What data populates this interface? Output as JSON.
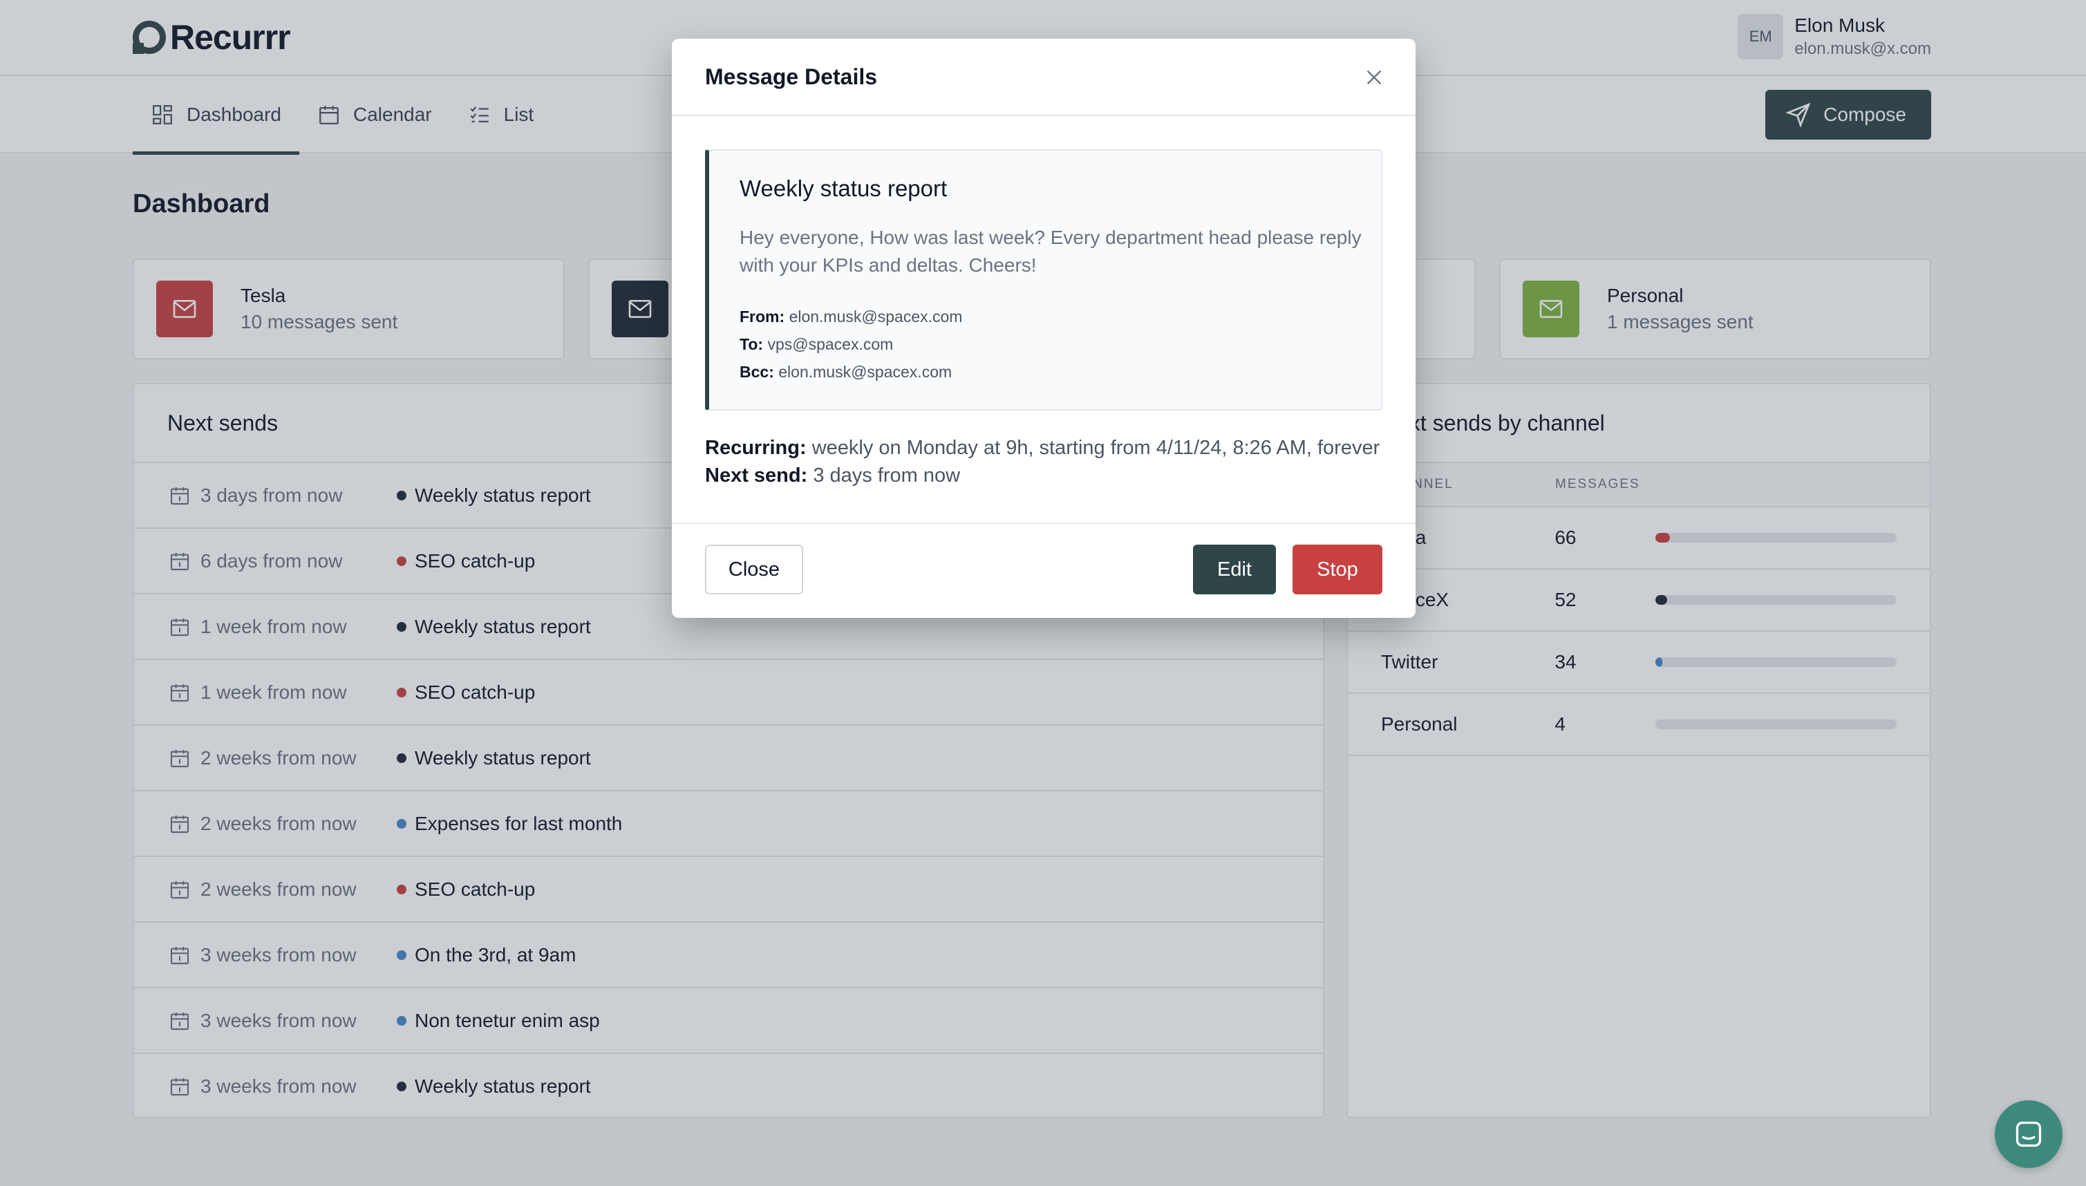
{
  "app": {
    "logo_text": "Recurrr"
  },
  "user": {
    "initials": "EM",
    "name": "Elon Musk",
    "email": "elon.musk@x.com"
  },
  "nav": {
    "tabs": [
      {
        "label": "Dashboard",
        "icon": "dashboard-icon",
        "active": true
      },
      {
        "label": "Calendar",
        "icon": "calendar-icon",
        "active": false
      },
      {
        "label": "List",
        "icon": "list-icon",
        "active": false
      }
    ],
    "compose_label": "Compose"
  },
  "page": {
    "title": "Dashboard"
  },
  "channels": [
    {
      "name": "Tesla",
      "count": "10 messages sent",
      "color": "#c84141"
    },
    {
      "name": "",
      "count": "",
      "color": "#1f2937"
    },
    {
      "name": "",
      "count": "",
      "color": "#ffffff"
    },
    {
      "name": "Personal",
      "count": "1 messages sent",
      "color": "#7fb342"
    }
  ],
  "next_sends": {
    "title": "Next sends",
    "rows": [
      {
        "when": "3 days from now",
        "what": "Weekly status report",
        "color": "#1f2937"
      },
      {
        "when": "6 days from now",
        "what": "SEO catch-up",
        "color": "#c84141"
      },
      {
        "when": "1 week from now",
        "what": "Weekly status report",
        "color": "#1f2937"
      },
      {
        "when": "1 week from now",
        "what": "SEO catch-up",
        "color": "#c84141"
      },
      {
        "when": "2 weeks from now",
        "what": "Weekly status report",
        "color": "#1f2937"
      },
      {
        "when": "2 weeks from now",
        "what": "Expenses for last month",
        "color": "#4a86c8"
      },
      {
        "when": "2 weeks from now",
        "what": "SEO catch-up",
        "color": "#c84141"
      },
      {
        "when": "3 weeks from now",
        "what": "On the 3rd, at 9am",
        "color": "#4a86c8"
      },
      {
        "when": "3 weeks from now",
        "what": "Non tenetur enim asp",
        "color": "#4a86c8"
      },
      {
        "when": "3 weeks from now",
        "what": "Weekly status report",
        "color": "#1f2937"
      }
    ]
  },
  "by_channel": {
    "title": "Next sends by channel",
    "headers": {
      "channel": "CHANNEL",
      "messages": "MESSAGES"
    },
    "rows": [
      {
        "channel": "Tesla",
        "messages": "66",
        "fill": 0.06,
        "color": "#c84141"
      },
      {
        "channel": "SpaceX",
        "messages": "52",
        "fill": 0.05,
        "color": "#1f2937"
      },
      {
        "channel": "Twitter",
        "messages": "34",
        "fill": 0.03,
        "color": "#4a86c8"
      },
      {
        "channel": "Personal",
        "messages": "4",
        "fill": 0.0,
        "color": "#7fb342"
      }
    ]
  },
  "modal": {
    "title": "Message Details",
    "subject": "Weekly status report",
    "body": "Hey everyone, How was last week? Every department head please reply with your KPIs and deltas. Cheers!",
    "from_label": "From:",
    "from": "elon.musk@spacex.com",
    "to_label": "To:",
    "to": "vps@spacex.com",
    "bcc_label": "Bcc:",
    "bcc": "elon.musk@spacex.com",
    "recurring_label": "Recurring:",
    "recurring": "weekly on Monday at 9h, starting from 4/11/24, 8:26 AM, forever",
    "next_send_label": "Next send:",
    "next_send": "3 days from now",
    "close_label": "Close",
    "edit_label": "Edit",
    "stop_label": "Stop"
  }
}
